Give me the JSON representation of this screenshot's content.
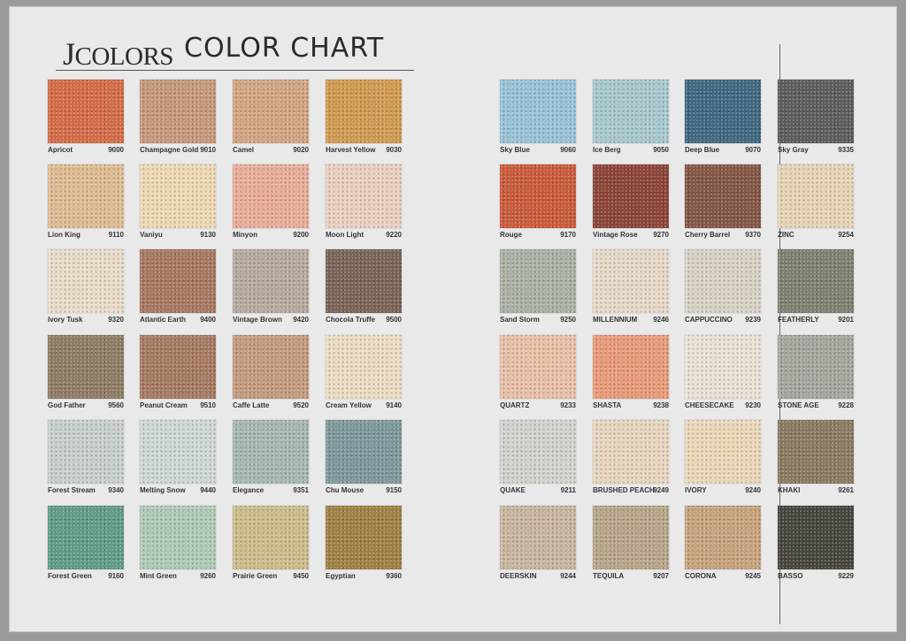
{
  "header": {
    "brand_first": "J",
    "brand_rest": "COLORS",
    "subtitle": "COLOR CHART"
  },
  "colors": {
    "left": [
      [
        {
          "name": "Apricot",
          "code": "9000",
          "hex": "#d66c47"
        },
        {
          "name": "Champagne Gold",
          "code": "9010",
          "hex": "#c7987a"
        },
        {
          "name": "Camel",
          "code": "9020",
          "hex": "#d3a582"
        },
        {
          "name": "Harvest Yellow",
          "code": "9030",
          "hex": "#d29a50"
        }
      ],
      [
        {
          "name": "Lion King",
          "code": "9110",
          "hex": "#e0bc93"
        },
        {
          "name": "Vaniyu",
          "code": "9130",
          "hex": "#efd9b4"
        },
        {
          "name": "Minyon",
          "code": "9200",
          "hex": "#eaad98"
        },
        {
          "name": "Moon Light",
          "code": "9220",
          "hex": "#ebcfc0"
        }
      ],
      [
        {
          "name": "Ivory Tusk",
          "code": "9320",
          "hex": "#eadcc8"
        },
        {
          "name": "Atlantic Earth",
          "code": "9400",
          "hex": "#a97860"
        },
        {
          "name": "Vintage Brown",
          "code": "9420",
          "hex": "#b8aa9f"
        },
        {
          "name": "Chocola Truffe",
          "code": "9500",
          "hex": "#7a6356"
        }
      ],
      [
        {
          "name": "God Father",
          "code": "9560",
          "hex": "#8e7c64"
        },
        {
          "name": "Peanut Cream",
          "code": "9510",
          "hex": "#a87a62"
        },
        {
          "name": "Caffe Latte",
          "code": "9520",
          "hex": "#c49b7e"
        },
        {
          "name": "Cream Yellow",
          "code": "9140",
          "hex": "#ecdcc2"
        }
      ],
      [
        {
          "name": "Forest Stream",
          "code": "9340",
          "hex": "#c9d0cc"
        },
        {
          "name": "Melting Snow",
          "code": "9440",
          "hex": "#cfd8d2"
        },
        {
          "name": "Elegance",
          "code": "9351",
          "hex": "#a6b8b4"
        },
        {
          "name": "Chu Mouse",
          "code": "9150",
          "hex": "#7e999c"
        }
      ],
      [
        {
          "name": "Forest Green",
          "code": "9160",
          "hex": "#5f9d86"
        },
        {
          "name": "Mint Green",
          "code": "9260",
          "hex": "#afcbb6"
        },
        {
          "name": "Prairie Green",
          "code": "9450",
          "hex": "#cdbd8b"
        },
        {
          "name": "Egyptian",
          "code": "9360",
          "hex": "#9f8141"
        }
      ]
    ],
    "right": [
      [
        {
          "name": "Sky Blue",
          "code": "9060",
          "hex": "#98c3d8"
        },
        {
          "name": "Ice Berg",
          "code": "9050",
          "hex": "#a8c8d0"
        },
        {
          "name": "Deep Blue",
          "code": "9070",
          "hex": "#3f6881"
        },
        {
          "name": "Sky Gray",
          "code": "9335",
          "hex": "#5b5c5e"
        }
      ],
      [
        {
          "name": "Rouge",
          "code": "9170",
          "hex": "#cb5a3b"
        },
        {
          "name": "Vintage Rose",
          "code": "9270",
          "hex": "#8c4437"
        },
        {
          "name": "Cherry Barrel",
          "code": "9370",
          "hex": "#845644"
        },
        {
          "name": "ZINC",
          "code": "9254",
          "hex": "#e8d4b6"
        }
      ],
      [
        {
          "name": "Sand Storm",
          "code": "9250",
          "hex": "#aab1a6"
        },
        {
          "name": "MILLENNIUM",
          "code": "9246",
          "hex": "#e8d9c8"
        },
        {
          "name": "CAPPUCCINO",
          "code": "9239",
          "hex": "#d8d2c6"
        },
        {
          "name": "FEATHERLY",
          "code": "9201",
          "hex": "#7d8170"
        }
      ],
      [
        {
          "name": "QUARTZ",
          "code": "9233",
          "hex": "#e9c0a8"
        },
        {
          "name": "SHASTA",
          "code": "9238",
          "hex": "#ea9b78"
        },
        {
          "name": "CHEESECAKE",
          "code": "9230",
          "hex": "#eae3d4"
        },
        {
          "name": "STONE AGE",
          "code": "9228",
          "hex": "#a4a79e"
        }
      ],
      [
        {
          "name": "QUAKE",
          "code": "9211",
          "hex": "#d1d3cd"
        },
        {
          "name": "BRUSHED PEACH",
          "code": "9249",
          "hex": "#e8d6be"
        },
        {
          "name": "IVORY",
          "code": "9240",
          "hex": "#ecd8b9"
        },
        {
          "name": "KHAKI",
          "code": "9261",
          "hex": "#8b7a60"
        }
      ],
      [
        {
          "name": "DEERSKIN",
          "code": "9244",
          "hex": "#c9b6a0"
        },
        {
          "name": "TEQUILA",
          "code": "9207",
          "hex": "#b9a68a"
        },
        {
          "name": "CORONA",
          "code": "9245",
          "hex": "#c8a47e"
        },
        {
          "name": "BASSO",
          "code": "9229",
          "hex": "#46443c"
        }
      ]
    ]
  }
}
